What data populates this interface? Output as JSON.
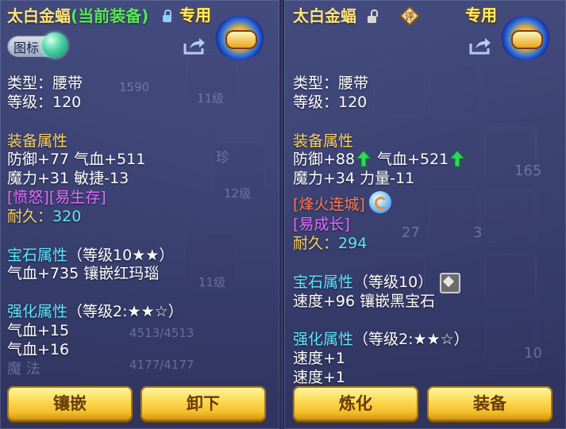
{
  "left": {
    "title": "太白金蝠",
    "title_status": "(当前装备)",
    "zhuanyong": "专用",
    "toggle_label": "图标",
    "type_line": "类型：腰带",
    "level_line": "等级：120",
    "equip_heading": "装备属性",
    "stat_line1": "防御+77 气血+511",
    "stat_line2": "魔力+31 敏捷-13",
    "special_line": "[愤怒][易生存]",
    "durability_label": "耐久：",
    "durability_value": "320",
    "gem_heading": "宝石属性",
    "gem_level": "（等级10★★）",
    "gem_line": "气血+735 镶嵌红玛瑙",
    "enh_heading": "强化属性",
    "enh_level": "（等级2:★★☆）",
    "enh_line1": "气血+15",
    "enh_line2": "气血+16",
    "btn_inlay": "镶嵌",
    "btn_unequip": "卸下"
  },
  "right": {
    "title": "太白金蝠",
    "ping": "评",
    "zhuanyong": "专用",
    "type_line": "类型：腰带",
    "level_line": "等级：120",
    "equip_heading": "装备属性",
    "stat_def": "防御+88",
    "stat_hp": "气血+521",
    "stat_line2": "魔力+34 力量-11",
    "special_line1": "[烽火连城]",
    "special_line2": "[易成长]",
    "durability_label": "耐久：",
    "durability_value": "294",
    "gem_heading": "宝石属性",
    "gem_level": "（等级10）",
    "gem_line": "速度+96 镶嵌黑宝石",
    "enh_heading": "强化属性",
    "enh_level": "（等级2:★★☆）",
    "enh_line1": "速度+1",
    "enh_line2": "速度+1",
    "btn_refine": "炼化",
    "btn_equip": "装备"
  },
  "background": {
    "t1": "1590",
    "t2": "11级",
    "t3": "12级",
    "t4": "11级",
    "t5": "4513/4513",
    "t6": "4177/4177",
    "t7": "魔 法",
    "t8": "165",
    "t9": "27",
    "t10": "3",
    "t11": "10",
    "t12": "珍"
  },
  "colors": {
    "title": "#ffe37a",
    "current_equip": "#57e857",
    "heading": "#ffd45a",
    "red_attr": "#ff7a52",
    "pink_attr": "#e46cff",
    "durability": "#5de8ff",
    "button": "#f3bf2a"
  },
  "icons": [
    "lock-icon",
    "unlock-icon",
    "share-icon",
    "equip-badge-icon",
    "up-arrow-icon",
    "refresh-icon",
    "gem-icon",
    "ping-icon",
    "toggle-knob"
  ]
}
